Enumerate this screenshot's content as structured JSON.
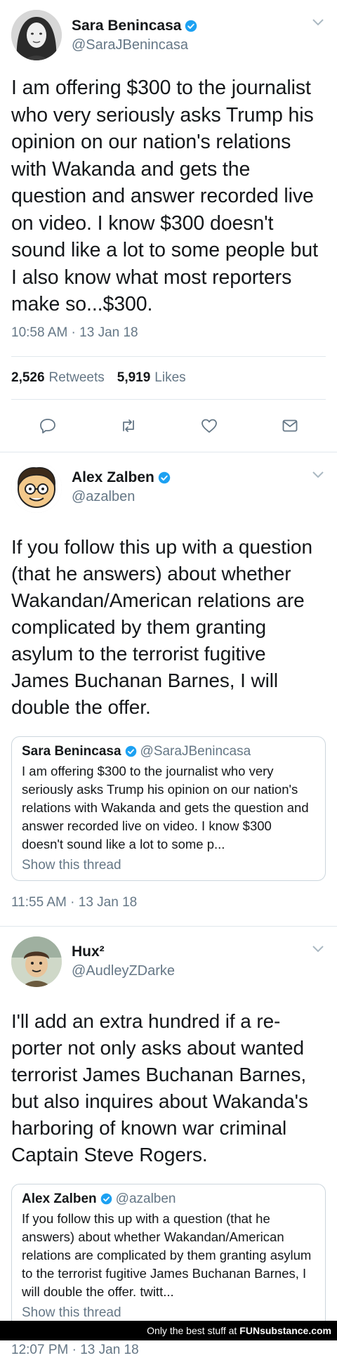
{
  "tweets": [
    {
      "name": "Sara Benincasa",
      "handle": "@SaraJBenincasa",
      "text": "I am offering $300 to the journalist who very seriously asks Trump his opinion on our nation's relations with Wakanda and gets the question and answer recorded live on video. I know $300 doesn't sound like a lot to some people but I also know what most reporters make so...$300.",
      "time": "10:58 AM · 13 Jan 18",
      "retweets_count": "2,526",
      "retweets_label": "Retweets",
      "likes_count": "5,919",
      "likes_label": "Likes"
    },
    {
      "name": "Alex Zalben",
      "handle": "@azalben",
      "text": "If you follow this up with a question (that he answers) about whether Wakandan/American relations are complicated by them granting asylum to the terrorist fugitive James Buchanan Barnes, I will double the offer.",
      "quote": {
        "name": "Sara Benincasa",
        "handle": "@SaraJBenincasa",
        "text": "I am offering $300 to the journalist who very seriously asks Trump his opinion on our nation's relations with Wakanda and gets the question and answer recorded live on video. I know $300 doesn't sound like a lot to some p...",
        "thread": "Show this thread"
      },
      "time": "11:55 AM · 13 Jan 18"
    },
    {
      "name": "Hux²",
      "handle": "@AudleyZDarke",
      "text": "I'll add an extra hundred if a re-porter not only asks about wanted terrorist James Buchanan Barnes, but also inquires about Wakanda's harboring of known war criminal Captain Steve Rogers.",
      "quote": {
        "name": "Alex Zalben",
        "handle": "@azalben",
        "text": "If you follow this up with a question (that he answers) about whether Wakandan/American relations are complicated by them granting asylum to the terrorist fugitive James Buchanan Barnes, I will double the offer. twitt...",
        "thread": "Show this thread"
      },
      "time": "12:07 PM · 13 Jan 18"
    }
  ],
  "watermark": {
    "text": "Only the best stuff at",
    "brand": "FUNsubstance.com"
  },
  "colors": {
    "verified": "#1da1f2",
    "secondary_text": "#657786",
    "border": "#e1e8ed"
  },
  "icons": [
    "verified-icon",
    "chevron-down-icon",
    "reply-icon",
    "retweet-icon",
    "like-icon",
    "message-icon"
  ]
}
